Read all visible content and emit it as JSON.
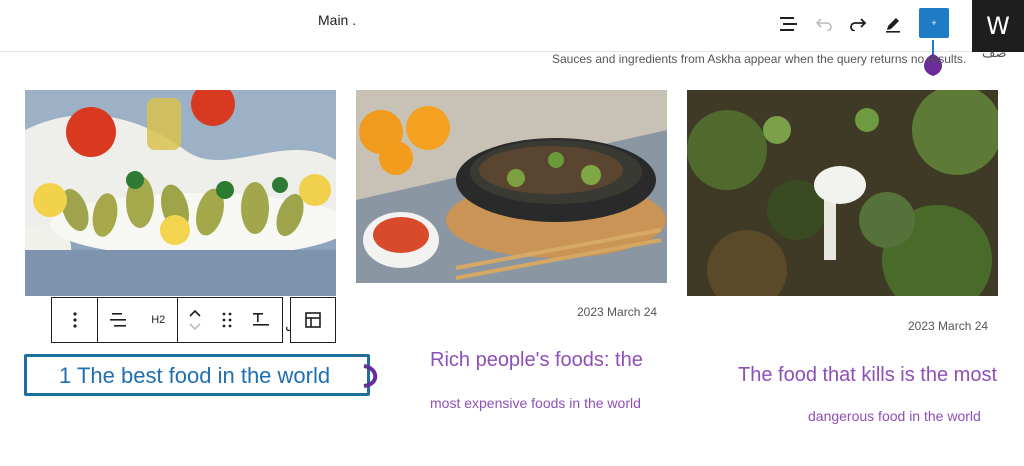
{
  "header": {
    "document_title": "Main .",
    "list_view_icon": "list-view-icon",
    "undo_icon": "undo-icon",
    "redo_icon": "redo-icon",
    "tools_icon": "pencil-icon",
    "inserter_label": "+",
    "wordpress_label": "W"
  },
  "notice": {
    "text": "Sauces and ingredients from Askha appear when the query returns no results.",
    "rtl_fragment": "صف"
  },
  "block_toolbar": {
    "options_icon": "more-vertical-icon",
    "block_type_icon": "align-icon",
    "heading_level": "H2",
    "move_icon": "chevron-updown-icon",
    "drag_icon": "drag-handle-icon",
    "text_align_icon": "text-align-icon",
    "layout_icon": "layout-icon",
    "stray_char": "ل"
  },
  "posts": [
    {
      "title": "1 The best food in the world",
      "image_alt": "stuffed zucchini with lemon and tomatoes"
    },
    {
      "date": "2023 March 24",
      "title": "Rich people's foods: the",
      "subtitle": "most expensive foods in the world",
      "image_alt": "beef stir fry with oranges and chopsticks"
    },
    {
      "date": "2023 March 24",
      "title": "The food that kills is the most",
      "subtitle": "dangerous food in the world",
      "image_alt": "white mushroom in a forest"
    }
  ],
  "colors": {
    "accent": "#1e7bc6",
    "title_purple": "#8e4fb8",
    "selected_border": "#1e6e9e",
    "marker_purple": "#6a2c9a"
  }
}
